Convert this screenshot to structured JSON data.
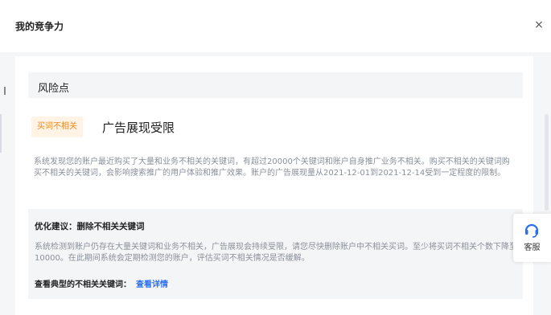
{
  "header": {
    "title": "我的竞争力",
    "close_glyph": "×"
  },
  "section": {
    "title": "风险点"
  },
  "risk": {
    "tag": "买词不相关",
    "headline": "广告展现受限",
    "description": "系统发现您的账户最近购买了大量和业务不相关的关键词，有超过20000个关键词和账户自身推广业务不相关。购买不相关的关键词购买不相关的关键词，会影响搜索推广的用户体验和推广效果。账户的广告展现量从2021-12-01到2021-12-14受到一定程度的限制。"
  },
  "advice": {
    "title": "优化建议：删除不相关关键词",
    "text": "系统检测到账户仍存在大量关键词和业务不相关，广告展现会持续受限，请您尽快删除账户中不相关买词。至少将买词不相关个数下降至10000。在此期间系统会定期检测您的账户，评估买词不相关情况是否缓解。",
    "link_label": "查看典型的不相关关键词：",
    "link_text": "查看详情"
  },
  "support": {
    "label": "客服",
    "icon": "headset-icon"
  },
  "colors": {
    "accent": "#2a6ff0",
    "tag_bg": "#fff3e6",
    "tag_fg": "#f0891a"
  }
}
